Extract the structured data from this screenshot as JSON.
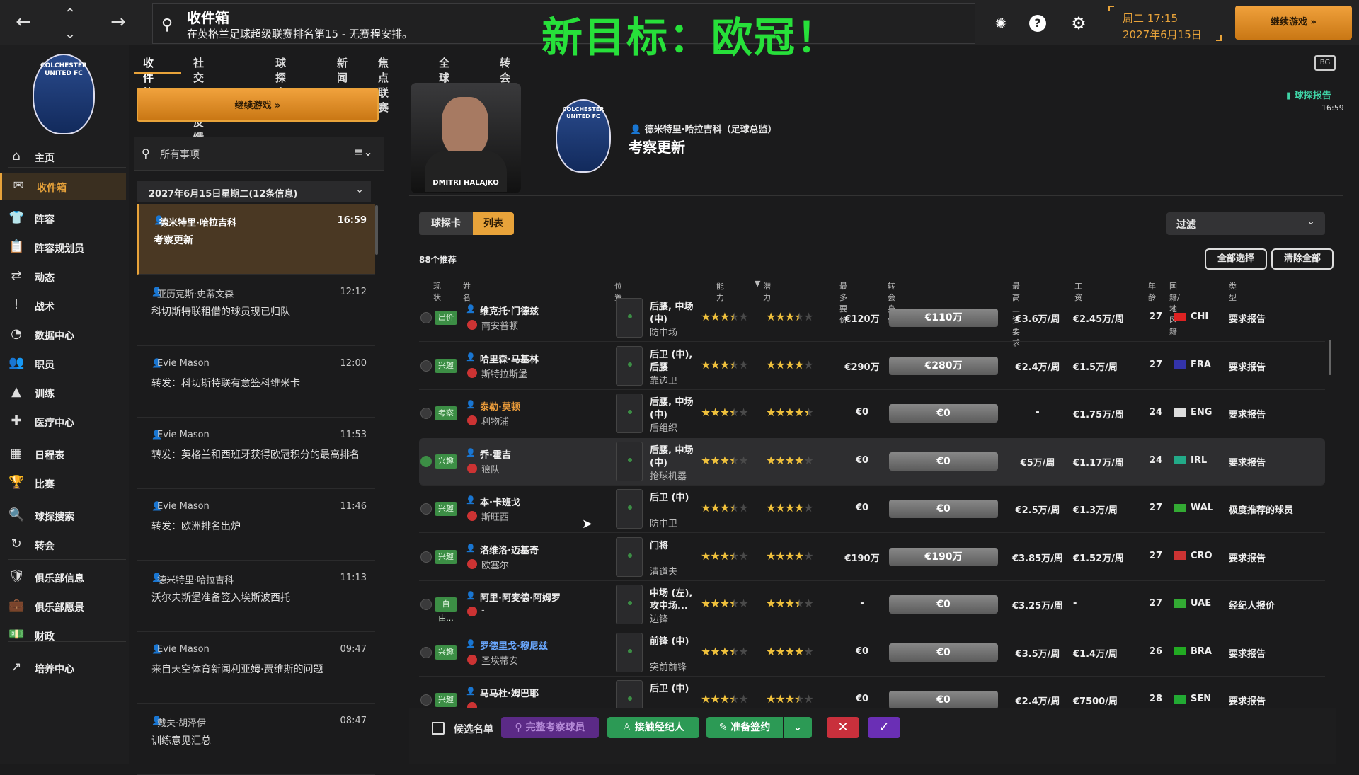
{
  "topbar": {
    "search_title": "收件箱",
    "search_sub": "在英格兰足球超级联赛排名第15 - 无赛程安排。",
    "overlay": "新目标：欧冠！",
    "date1": "周二 17:15",
    "date2": "2027年6月15日",
    "continue": "继续游戏 »",
    "back": "←",
    "fwd": "→",
    "up": "⌃",
    "down": "⌄"
  },
  "club": {
    "crest_text": "COLCHESTER UNITED FC"
  },
  "nav": [
    {
      "icon": "⌂",
      "label": "主页"
    },
    {
      "icon": "✉",
      "label": "收件箱"
    },
    {
      "icon": "👕",
      "label": "阵容"
    },
    {
      "icon": "📋",
      "label": "阵容规划员"
    },
    {
      "icon": "⇄",
      "label": "动态"
    },
    {
      "icon": "!",
      "label": "战术"
    },
    {
      "icon": "◔",
      "label": "数据中心"
    },
    {
      "icon": "👥",
      "label": "职员"
    },
    {
      "icon": "▲",
      "label": "训练"
    },
    {
      "icon": "✚",
      "label": "医疗中心"
    },
    {
      "icon": "▦",
      "label": "日程表"
    },
    {
      "icon": "🏆",
      "label": "比赛"
    },
    {
      "icon": "🔍",
      "label": "球探搜索"
    },
    {
      "icon": "↻",
      "label": "转会"
    },
    {
      "icon": "🛡",
      "label": "俱乐部信息"
    },
    {
      "icon": "💼",
      "label": "俱乐部愿景"
    },
    {
      "icon": "💵",
      "label": "财政"
    },
    {
      "icon": "↗",
      "label": "培养中心"
    }
  ],
  "tabs": [
    "收件箱",
    "社交网络反馈",
    "球探会议",
    "新闻",
    "焦点联赛",
    "全球要闻",
    "转会窗口新闻"
  ],
  "inbox": {
    "continue": "继续游戏 »",
    "search": "所有事项",
    "group": "2027年6月15日星期二(12条信息)"
  },
  "messages": [
    {
      "from": "德米特里·哈拉吉科",
      "time": "16:59",
      "subject": "考察更新"
    },
    {
      "from": "亚历克斯·史蒂文森",
      "time": "12:12",
      "subject": "科切斯特联租借的球员现已归队"
    },
    {
      "from": "Evie Mason",
      "time": "12:00",
      "subject": "转发：科切斯特联有意签科维米卡"
    },
    {
      "from": "Evie Mason",
      "time": "11:53",
      "subject": "转发：英格兰和西班牙获得欧冠积分的最高排名"
    },
    {
      "from": "Evie Mason",
      "time": "11:46",
      "subject": "转发：欧洲排名出炉"
    },
    {
      "from": "德米特里·哈拉吉科",
      "time": "11:13",
      "subject": "沃尔夫斯堡准备签入埃斯波西托"
    },
    {
      "from": "Evie Mason",
      "time": "09:47",
      "subject": "来自天空体育新闻利亚姆·贾维斯的问题"
    },
    {
      "from": "戴夫·胡泽伊",
      "time": "08:47",
      "subject": "训练意见汇总"
    }
  ],
  "detail": {
    "photo_caption": "DMITRI HALAJKO",
    "sender": "德米特里·哈拉吉科（足球总监）",
    "title": "考察更新",
    "report_label": "球探报告",
    "report_time": "16:59",
    "view_card": "球探卡",
    "view_list": "列表",
    "filter": "过滤",
    "count": "88个推荐",
    "select_all": "全部选择",
    "clear_all": "清除全部"
  },
  "columns": [
    "现状",
    "姓名",
    "位置",
    "能力",
    "潜力",
    "最多要价",
    "转会身价",
    "最高工资要求",
    "工资",
    "年龄",
    "国籍/地区籍",
    "类型"
  ],
  "players": [
    {
      "status": "出价",
      "name": "维克托·门德兹",
      "club": "南安普顿",
      "pos1": "后腰, 中场",
      "pos2": "(中)",
      "role": "防中场",
      "ab": 3.5,
      "pot": 3.5,
      "ask": "€120万",
      "value": "€110万",
      "maxwage": "€3.6万/周",
      "wage": "€2.45万/周",
      "age": "27",
      "nat": "CHI",
      "type": "要求报告",
      "name_color": "#eee",
      "flag": "#d22"
    },
    {
      "status": "兴趣",
      "name": "哈里森·马基林",
      "club": "斯特拉斯堡",
      "pos1": "后卫 (中),",
      "pos2": "后腰",
      "role": "靠边卫",
      "ab": 3.5,
      "pot": 4,
      "ask": "€290万",
      "value": "€280万",
      "maxwage": "€2.4万/周",
      "wage": "€1.5万/周",
      "age": "27",
      "nat": "FRA",
      "type": "要求报告",
      "name_color": "#eee",
      "flag": "#33a"
    },
    {
      "status": "考察",
      "name": "泰勒·莫顿",
      "club": "利物浦",
      "pos1": "后腰, 中场",
      "pos2": "(中)",
      "role": "后组织",
      "ab": 3.5,
      "pot": 4.5,
      "ask": "€0",
      "value": "€0",
      "maxwage": "-",
      "wage": "€1.75万/周",
      "age": "24",
      "nat": "ENG",
      "type": "要求报告",
      "name_color": "#e89a3a",
      "flag": "#ddd"
    },
    {
      "status": "兴趣",
      "name": "乔·霍吉",
      "club": "狼队",
      "pos1": "后腰, 中场",
      "pos2": "(中)",
      "role": "抢球机器",
      "ab": 3.5,
      "pot": 4,
      "ask": "€0",
      "value": "€0",
      "maxwage": "€5万/周",
      "wage": "€1.17万/周",
      "age": "24",
      "nat": "IRL",
      "type": "要求报告",
      "name_color": "#eee",
      "flag": "#2a8"
    },
    {
      "status": "兴趣",
      "name": "本·卡班戈",
      "club": "斯旺西",
      "pos1": "后卫 (中)",
      "pos2": "",
      "role": "防中卫",
      "ab": 3.5,
      "pot": 4,
      "ask": "€0",
      "value": "€0",
      "maxwage": "€2.5万/周",
      "wage": "€1.3万/周",
      "age": "27",
      "nat": "WAL",
      "type": "极度推荐的球员",
      "name_color": "#eee",
      "flag": "#3a3"
    },
    {
      "status": "兴趣",
      "name": "洛维洛·迈基奇",
      "club": "欧塞尔",
      "pos1": "门将",
      "pos2": "",
      "role": "清道夫",
      "ab": 3.5,
      "pot": 4,
      "ask": "€190万",
      "value": "€190万",
      "maxwage": "€3.85万/周",
      "wage": "€1.52万/周",
      "age": "27",
      "nat": "CRO",
      "type": "要求报告",
      "name_color": "#eee",
      "flag": "#c33"
    },
    {
      "status": "自由...",
      "name": "阿里·阿麦德·阿姆罗",
      "club": "-",
      "pos1": "中场 (左),",
      "pos2": "攻中场...",
      "role": "边锋",
      "ab": 3.5,
      "pot": 3.5,
      "ask": "-",
      "value": "€0",
      "maxwage": "€3.25万/周",
      "wage": "-",
      "age": "27",
      "nat": "UAE",
      "type": "经纪人报价",
      "name_color": "#eee",
      "flag": "#3a3"
    },
    {
      "status": "兴趣",
      "name": "罗德里戈·穆尼兹",
      "club": "圣埃蒂安",
      "pos1": "前锋 (中)",
      "pos2": "",
      "role": "突前前锋",
      "ab": 3.5,
      "pot": 4,
      "ask": "€0",
      "value": "€0",
      "maxwage": "€3.5万/周",
      "wage": "€1.4万/周",
      "age": "26",
      "nat": "BRA",
      "type": "要求报告",
      "name_color": "#6aa8ff",
      "flag": "#2a2"
    },
    {
      "status": "兴趣",
      "name": "马马杜·姆巴耶",
      "club": "",
      "pos1": "后卫 (中)",
      "pos2": "",
      "role": "",
      "ab": 3.5,
      "pot": 3.5,
      "ask": "€0",
      "value": "€0",
      "maxwage": "€2.4万/周",
      "wage": "€7500/周",
      "age": "28",
      "nat": "SEN",
      "type": "要求报告",
      "name_color": "#eee",
      "flag": "#2a3"
    }
  ],
  "bottom": {
    "shortlist": "候选名单",
    "scout": "完整考察球员",
    "agent": "接触经纪人",
    "sign": "准备签约"
  }
}
